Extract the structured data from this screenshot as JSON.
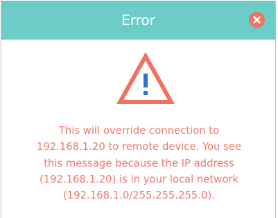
{
  "dialog": {
    "title": "Error",
    "close_icon": "close-icon",
    "warning_icon": "warning-triangle-icon",
    "message_lines": [
      "This will override connection to",
      "192.168.1.20 to remote device. You see",
      "this message because the IP address",
      "(192.168.1.20) is in your local network",
      "(192.168.1.0/255.255.255.0)."
    ]
  },
  "colors": {
    "titlebar": "#6ccdc8",
    "title_text": "#ffffff",
    "accent": "#f0735f",
    "icon_mark": "#2f6fd6",
    "message_text": "#f2786a"
  }
}
